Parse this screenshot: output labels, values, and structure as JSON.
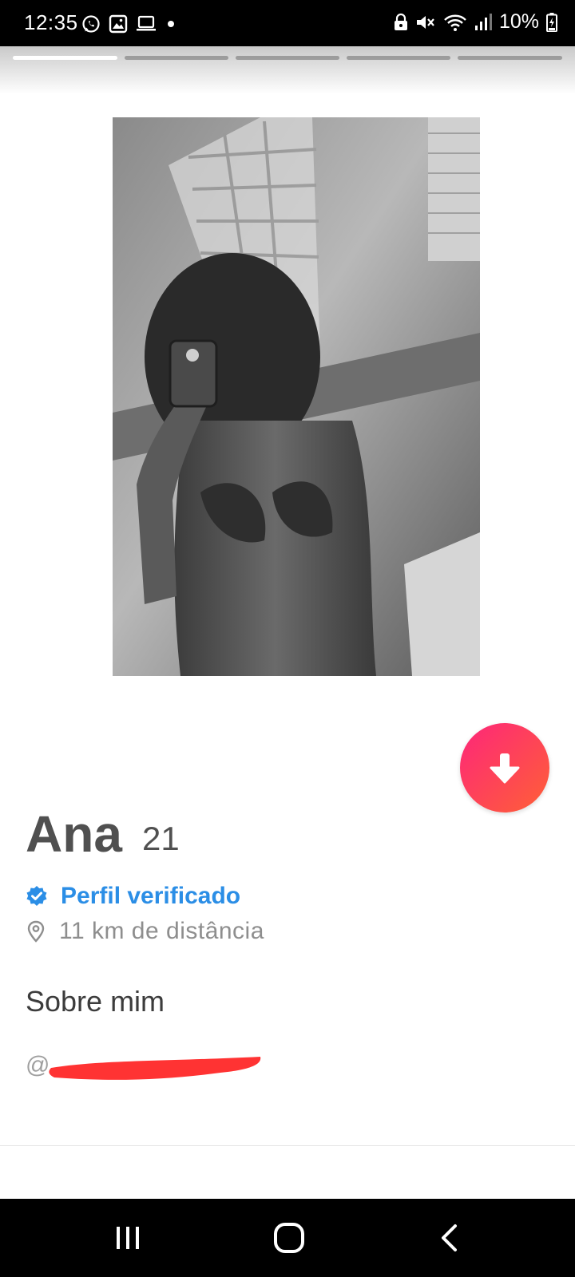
{
  "status_bar": {
    "time": "12:35",
    "battery": "10%",
    "left_icons": [
      "whatsapp-icon",
      "gallery-icon",
      "laptop-icon",
      "dot-icon"
    ],
    "right_icons": [
      "lock-icon",
      "mute-icon",
      "wifi-icon",
      "signal-icon",
      "battery-charging-icon"
    ]
  },
  "story_progress": {
    "segments": 5,
    "active_index": 0
  },
  "profile": {
    "name": "Ana",
    "age": "21",
    "verified_label": "Perfil verificado",
    "distance": "11 km de distância",
    "about_title": "Sobre mim",
    "bio_prefix": "@"
  },
  "colors": {
    "accent_gradient_start": "#fd267a",
    "accent_gradient_end": "#ff6036",
    "verified_blue": "#2b8ee6",
    "name_gray": "#505050",
    "redaction_red": "#ff3333"
  },
  "actions": {
    "collapse_icon": "arrow-down-icon"
  },
  "nav_bar": {
    "buttons": [
      "recent-apps-icon",
      "home-icon",
      "back-icon"
    ]
  }
}
